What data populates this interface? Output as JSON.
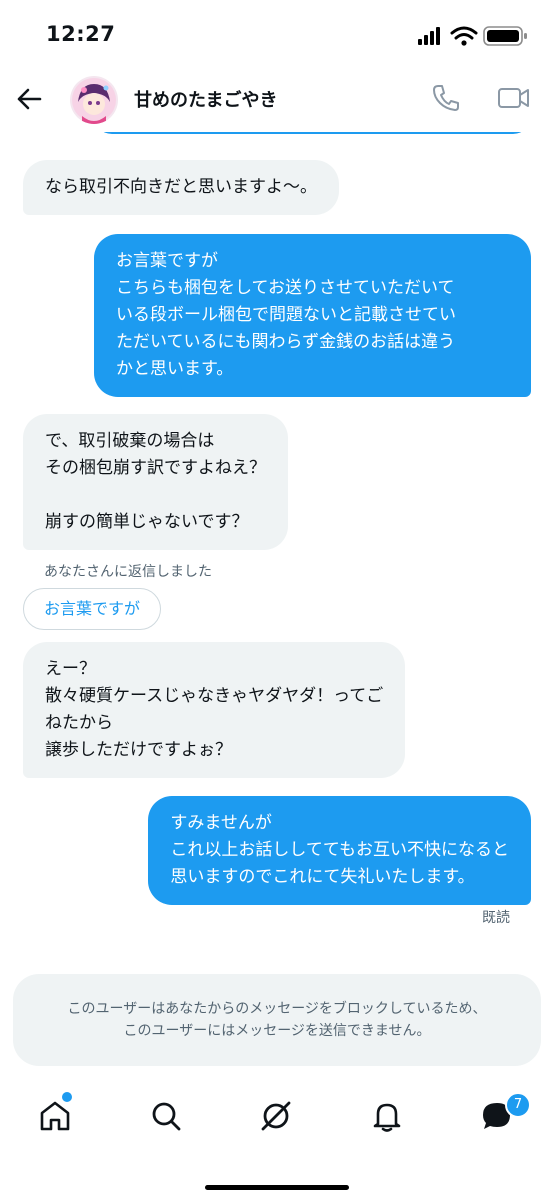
{
  "status_bar": {
    "time": "12:27"
  },
  "header": {
    "name": "甘めのたまごやき"
  },
  "messages": [
    {
      "dir": "in",
      "text": "なら取引不向きだと思いますよ〜。"
    },
    {
      "dir": "out",
      "text": "お言葉ですが\nこちらも梱包をしてお送りさせていただいて\nいる段ボール梱包で問題ないと記載させてい\nただいているにも関わらず金銭のお話は違う\nかと思います。"
    },
    {
      "dir": "in",
      "text": "で、取引破棄の場合は\nその梱包崩す訳ですよねえ？\n\n崩すの簡単じゃないです？"
    },
    {
      "dir": "in",
      "text": "えー？\n散々硬質ケースじゃなきゃヤダヤダ！ってご\nねたから\n譲歩しただけですよぉ？"
    },
    {
      "dir": "out",
      "text": "すみませんが\nこれ以上お話ししててもお互い不快になると\n思いますのでこれにて失礼いたします。"
    }
  ],
  "reply_note": "あなたさんに返信しました",
  "reply_quote": "お言葉ですが",
  "read_receipt": "既読",
  "blocked_notice": {
    "line1": "このユーザーはあなたからのメッセージをブロックしているため、",
    "line2": "このユーザーにはメッセージを送信できません。"
  },
  "nav": {
    "items": [
      "home-icon",
      "search-icon",
      "grok-icon",
      "notifications-icon",
      "messages-icon"
    ],
    "messages_badge": "7"
  },
  "colors": {
    "accent": "#1d9bf0",
    "incoming_bg": "#eff3f4",
    "muted": "#536471"
  }
}
